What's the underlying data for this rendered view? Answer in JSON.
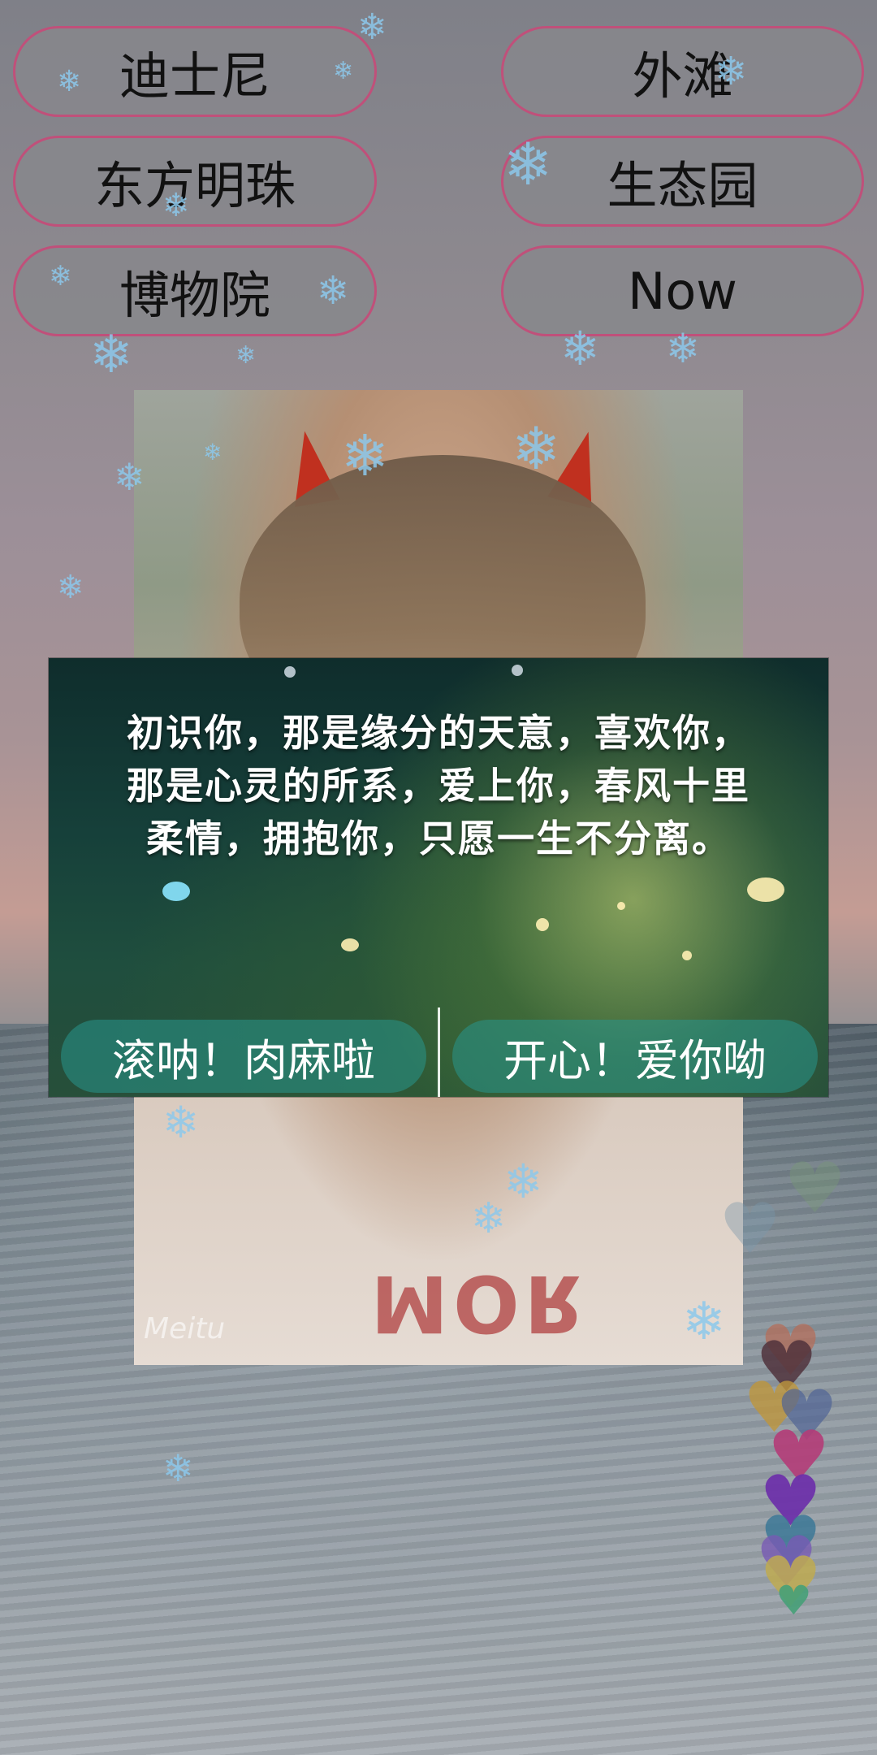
{
  "top_buttons": {
    "disney": "迪士尼",
    "bund": "外滩",
    "oriental_pearl": "东方明珠",
    "eco_park": "生态园",
    "museum": "博物院",
    "now": "Now"
  },
  "photo": {
    "shirt_text": "ЯOM",
    "watermark": "Meitu"
  },
  "dialog": {
    "message": "初识你，那是缘分的天意，喜欢你，那是心灵的所系，爱上你，春风十里柔情，拥抱你，只愿一生不分离。",
    "negative_button": "滚呐！肉麻啦",
    "positive_button": "开心！爱你呦"
  },
  "colors": {
    "button_border": "#c0507a",
    "dialog_button": "#2aa08f"
  },
  "icons": [
    "snowflake-icon",
    "heart-icon"
  ]
}
